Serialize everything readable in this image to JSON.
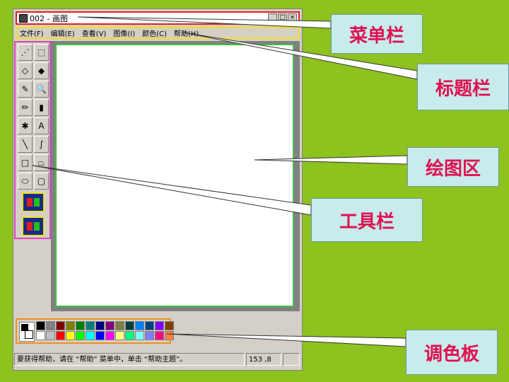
{
  "window": {
    "title": "002 - 画图",
    "buttons": [
      "_",
      "□",
      "×"
    ]
  },
  "menubar": {
    "items": [
      "文件(F)",
      "编辑(E)",
      "查看(V)",
      "图像(I)",
      "颜色(C)",
      "帮助(H)"
    ]
  },
  "toolbox": {
    "tools": [
      "free-select-icon",
      "rect-select-icon",
      "eraser-icon",
      "fill-icon",
      "picker-icon",
      "magnifier-icon",
      "pencil-icon",
      "brush-icon",
      "airbrush-icon",
      "text-icon",
      "line-icon",
      "curve-icon",
      "rectangle-icon",
      "polygon-icon",
      "ellipse-icon",
      "rounded-rect-icon"
    ],
    "glyphs": [
      "⋰",
      "⬚",
      "◇",
      "◆",
      "✎",
      "🔍",
      "✏",
      "▮",
      "✱",
      "A",
      "╲",
      "∫",
      "□",
      "⏢",
      "⬭",
      "▢"
    ]
  },
  "palette": {
    "colors": [
      "#000000",
      "#808080",
      "#800000",
      "#808000",
      "#008000",
      "#008080",
      "#000080",
      "#800080",
      "#808040",
      "#004040",
      "#0080ff",
      "#004080",
      "#8000ff",
      "#804000",
      "#ffffff",
      "#c0c0c0",
      "#ff0000",
      "#ffff00",
      "#00ff00",
      "#00ffff",
      "#0000ff",
      "#ff00ff",
      "#ffff80",
      "#00ff80",
      "#80ffff",
      "#8080ff",
      "#ff0080",
      "#ff8040"
    ]
  },
  "statusbar": {
    "help_text": "要获得帮助，请在 “帮助” 菜单中，单击 “帮助主题”。",
    "coords": "153 ,8"
  },
  "callouts": {
    "menubar_label": "菜单栏",
    "titlebar_label": "标题栏",
    "canvas_label": "绘图区",
    "toolbox_label": "工具栏",
    "palette_label": "调色板"
  }
}
